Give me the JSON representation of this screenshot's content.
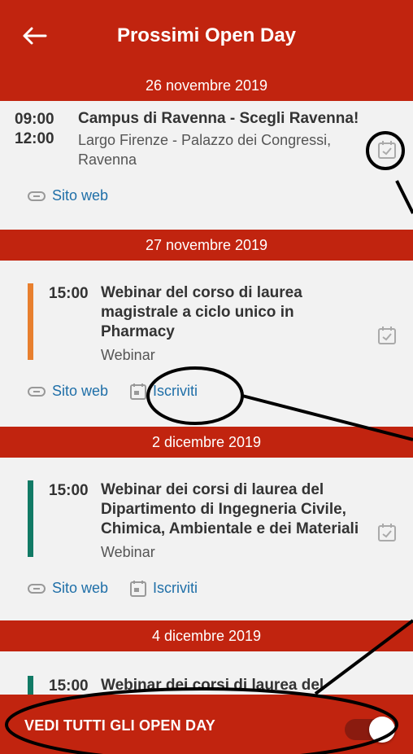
{
  "header": {
    "title": "Prossimi Open Day",
    "back_icon": "back-arrow-icon"
  },
  "events": [
    {
      "date": "26 novembre 2019",
      "start": "09:00",
      "end": "12:00",
      "title": "Campus di Ravenna - Scegli Ravenna!",
      "location_line1": "Largo Firenze - Palazzo dei Congressi,",
      "location_line2": "Ravenna",
      "website_label": "Sito web"
    },
    {
      "date": "27 novembre 2019",
      "start": "15:00",
      "title_lines": [
        "Webinar del corso di laurea",
        "magistrale a ciclo unico in",
        "Pharmacy"
      ],
      "type": "Webinar",
      "website_label": "Sito web",
      "signup_label": "Iscriviti",
      "accent_color": "#e87f2e"
    },
    {
      "date": "2 dicembre 2019",
      "start": "15:00",
      "title_lines": [
        "Webinar dei corsi di laurea del",
        "Dipartimento di Ingegneria Civile,",
        "Chimica, Ambientale e dei Materiali"
      ],
      "type": "Webinar",
      "website_label": "Sito web",
      "signup_label": "Iscriviti",
      "accent_color": "#117a65"
    },
    {
      "date": "4 dicembre 2019",
      "start": "15:00",
      "title_partial": "Webinar dei corsi di laurea del",
      "accent_color": "#117a65"
    }
  ],
  "footer": {
    "label": "VEDI TUTTI GLI OPEN DAY",
    "toggle_on": true
  },
  "colors": {
    "brand_red": "#c1240f",
    "link_blue": "#1f6fa8"
  }
}
